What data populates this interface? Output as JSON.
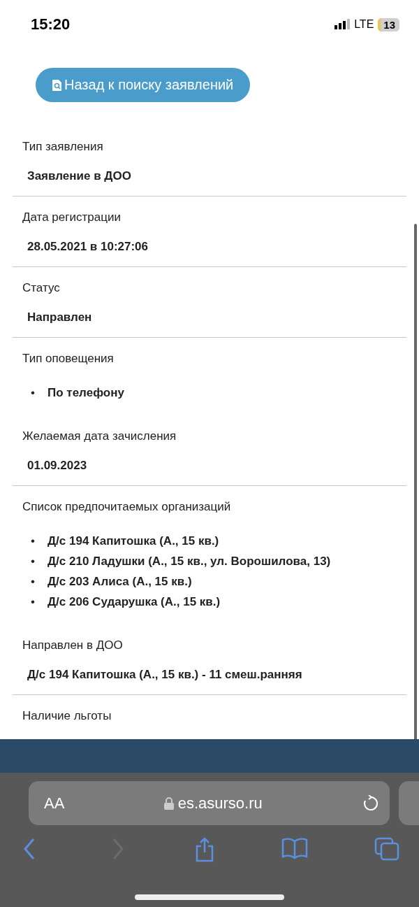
{
  "status_bar": {
    "time": "15:20",
    "network": "LTE",
    "battery": "13"
  },
  "back_button": {
    "label": "Назад к поиску заявлений"
  },
  "fields": [
    {
      "label": "Тип заявления",
      "kind": "text",
      "value": "Заявление в ДОО",
      "divider": true
    },
    {
      "label": "Дата регистрации",
      "kind": "text",
      "value": "28.05.2021 в 10:27:06",
      "divider": true
    },
    {
      "label": "Статус",
      "kind": "text",
      "value": "Направлен",
      "divider": true
    },
    {
      "label": "Тип оповещения",
      "kind": "list",
      "bullet": "•",
      "items": [
        "По телефону"
      ],
      "divider": false
    },
    {
      "label": "Желаемая дата зачисления",
      "kind": "text",
      "value": "01.09.2023",
      "divider": true
    },
    {
      "label": "Список предпочитаемых организаций",
      "kind": "list",
      "bullet": "•",
      "items": [
        "Д/с 194 Капитошка (А., 15 кв.)",
        "Д/с 210 Ладушки (А., 15 кв., ул. Ворошилова, 13)",
        "Д/с 203 Алиса (А., 15 кв.)",
        "Д/с 206 Сударушка (А., 15 кв.)"
      ],
      "divider": false
    },
    {
      "label": "Направлен в ДОО",
      "kind": "text",
      "value": "Д/с 194 Капитошка (А., 15 кв.) - 11 смеш.ранняя",
      "divider": true
    },
    {
      "label": "Наличие льготы",
      "kind": "label",
      "divider": false
    }
  ],
  "browser": {
    "text_size": "AA",
    "url": "es.asurso.ru"
  }
}
